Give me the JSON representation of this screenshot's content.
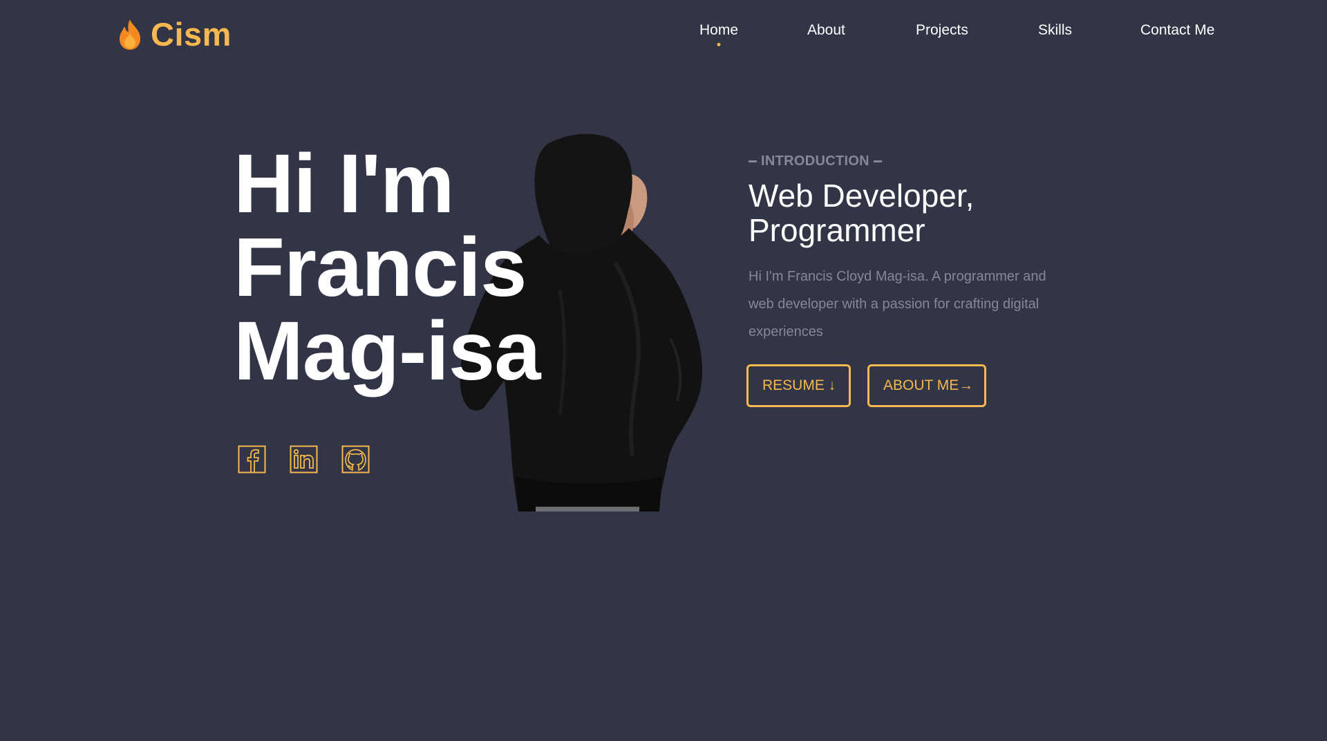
{
  "brand": {
    "logo_icon": "flame-icon",
    "name": "Cism"
  },
  "nav": {
    "active": "Home",
    "items": [
      {
        "label": "Home"
      },
      {
        "label": "About"
      },
      {
        "label": "Projects"
      },
      {
        "label": "Skills"
      },
      {
        "label": "Contact Me"
      }
    ]
  },
  "hero": {
    "title_lines": [
      "Hi I'm",
      "Francis",
      "Mag-isa"
    ],
    "image": "person-in-black-hoodie"
  },
  "socials": [
    {
      "icon": "facebook-icon"
    },
    {
      "icon": "linkedin-icon"
    },
    {
      "icon": "github-icon"
    }
  ],
  "intro": {
    "label": "INTRODUCTION",
    "heading_lines": [
      "Web Developer,",
      "Programmer"
    ],
    "body": "Hi I'm Francis Cloyd Mag-isa. A programmer and web developer with a passion for crafting digital experiences",
    "buttons": {
      "resume": "RESUME ↓",
      "about": "ABOUT ME→"
    }
  },
  "colors": {
    "background": "#323546",
    "accent": "#f7b84f",
    "muted_text": "#85879a",
    "text": "#ffffff"
  }
}
